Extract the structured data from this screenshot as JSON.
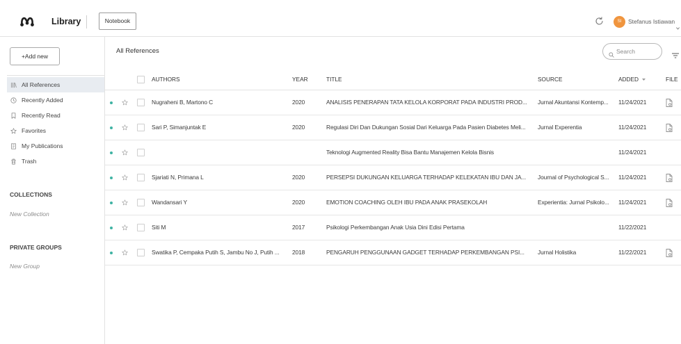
{
  "header": {
    "logo": "mendeley-logo",
    "section_title": "Library",
    "notebook_button": "Notebook",
    "sync_icon": "refresh-icon",
    "user": {
      "initials": "SI",
      "name": "Stefanus Istiawan",
      "menu_icon": "chevron-down-icon"
    }
  },
  "sidebar": {
    "add_new_button": "+Add new",
    "nav": [
      {
        "label": "All References",
        "icon": "library-icon",
        "selected": true
      },
      {
        "label": "Recently Added",
        "icon": "clock-icon",
        "selected": false
      },
      {
        "label": "Recently Read",
        "icon": "bookmark-icon",
        "selected": false
      },
      {
        "label": "Favorites",
        "icon": "star-icon",
        "selected": false
      },
      {
        "label": "My Publications",
        "icon": "document-icon",
        "selected": false
      },
      {
        "label": "Trash",
        "icon": "trash-icon",
        "selected": false
      }
    ],
    "collections": {
      "heading": "COLLECTIONS",
      "new_item": "New Collection"
    },
    "private_groups": {
      "heading": "PRIVATE GROUPS",
      "new_item": "New Group"
    }
  },
  "main": {
    "title": "All References",
    "search": {
      "placeholder": "Search",
      "icon": "search-icon"
    },
    "filter_icon": "filter-icon",
    "table": {
      "columns": {
        "authors": "AUTHORS",
        "year": "YEAR",
        "title": "TITLE",
        "source": "SOURCE",
        "added": "ADDED",
        "file": "FILE"
      },
      "sort_icon": "sort-descending-icon",
      "rows": [
        {
          "unread": true,
          "favorite": false,
          "authors": "Nugraheni B, Martono C",
          "year": "2020",
          "title": "ANALISIS PENERAPAN TATA KELOLA KORPORAT PADA INDUSTRI PROD...",
          "source": "Jurnal Akuntansi Kontemp...",
          "added": "11/24/2021",
          "has_file": true
        },
        {
          "unread": true,
          "favorite": false,
          "authors": "Sari P, Simanjuntak E",
          "year": "2020",
          "title": "Regulasi Diri Dan Dukungan Sosial Dari Keluarga Pada Pasien Diabetes Meli...",
          "source": "Jurnal Experentia",
          "added": "11/24/2021",
          "has_file": true
        },
        {
          "unread": true,
          "favorite": false,
          "authors": "",
          "year": "",
          "title": "Teknologi Augmented Reality Bisa Bantu Manajemen Kelola Bisnis",
          "source": "",
          "added": "11/24/2021",
          "has_file": false
        },
        {
          "unread": true,
          "favorite": false,
          "authors": "Sjariati N, Primana L",
          "year": "2020",
          "title": "PERSEPSI DUKUNGAN KELUARGA TERHADAP KELEKATAN IBU DAN JA...",
          "source": "Journal of Psychological S...",
          "added": "11/24/2021",
          "has_file": true
        },
        {
          "unread": true,
          "favorite": false,
          "authors": "Wandansari Y",
          "year": "2020",
          "title": "EMOTION COACHING OLEH IBU PADA ANAK PRASEKOLAH",
          "source": "Experientia: Jurnal Psikolo...",
          "added": "11/24/2021",
          "has_file": true
        },
        {
          "unread": true,
          "favorite": false,
          "authors": "Siti M",
          "year": "2017",
          "title": "Psikologi Perkembangan Anak Usia Dini Edisi Pertama",
          "source": "",
          "added": "11/22/2021",
          "has_file": false
        },
        {
          "unread": true,
          "favorite": false,
          "authors": "Swatika P, Cempaka Putih S, Jambu No J, Putih ...",
          "year": "2018",
          "title": "PENGARUH PENGGUNAAN GADGET TERHADAP PERKEMBANGAN PSI...",
          "source": "Jurnal Holistika",
          "added": "11/22/2021",
          "has_file": true
        }
      ]
    }
  },
  "colors": {
    "unread_dot": "#3fb3a3",
    "avatar": "#f0953e",
    "selected_nav_background": "#e8ecf1",
    "text": "#3b3b3b",
    "muted_text": "#8c8c8c",
    "divider": "#e2e2e2"
  }
}
